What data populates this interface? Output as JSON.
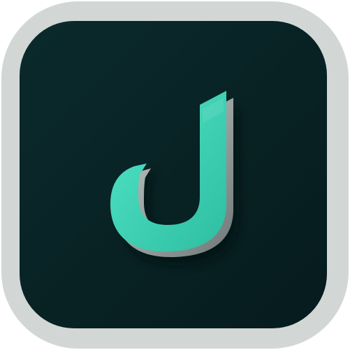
{
  "icon": {
    "glyph": "J",
    "name": "j-letter-icon",
    "colors": {
      "outer_frame": "#d2d7d6",
      "tile_top": "#0b2a2c",
      "tile_bottom": "#061b1d",
      "glyph_face_light": "#52e6c7",
      "glyph_face_dark": "#2ebda1",
      "glyph_extrusion_light": "#c9cfce",
      "glyph_extrusion_dark": "#6f7877",
      "glyph_shadow": "#020c0d"
    }
  }
}
